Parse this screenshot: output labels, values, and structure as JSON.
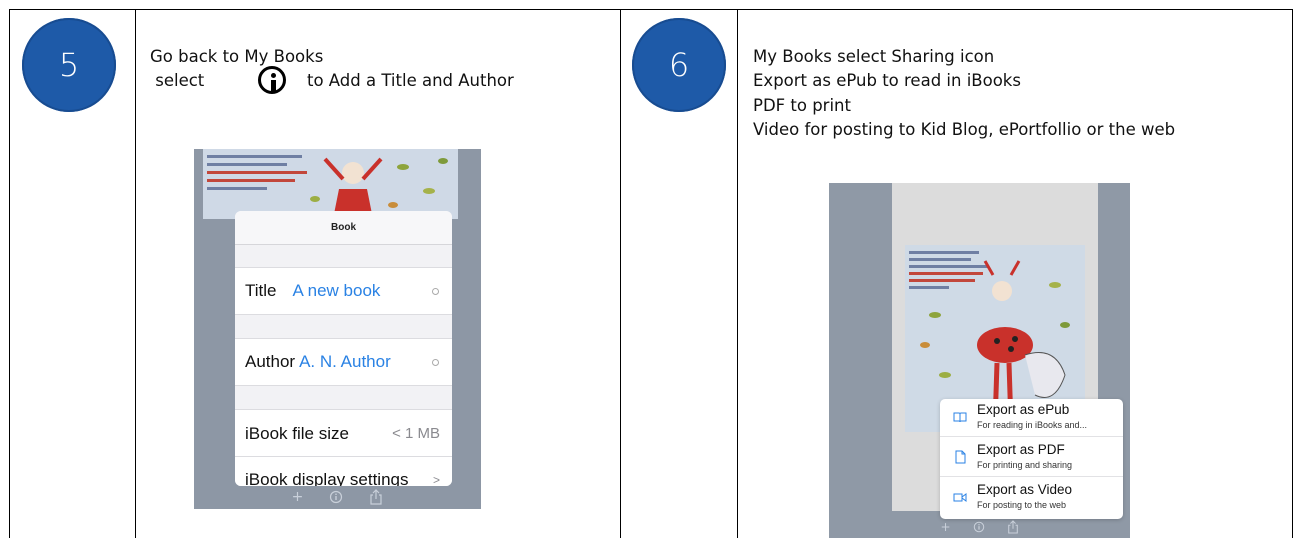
{
  "steps": [
    {
      "number": "5",
      "lines": [
        "Go back to My Books",
        " select",
        "to Add a Title and Author"
      ],
      "screen": {
        "sheet_title": "Book",
        "rows": [
          {
            "label": "Title",
            "value": "A new book"
          },
          {
            "label": "Author",
            "value": "A. N. Author"
          },
          {
            "label": "iBook file size",
            "value": "< 1 MB"
          },
          {
            "label": "iBook display settings",
            "value": ">"
          }
        ],
        "toolbar_icons": [
          "plus-icon",
          "info-icon",
          "share-icon"
        ]
      }
    },
    {
      "number": "6",
      "lines": [
        "My Books select Sharing icon",
        "Export as ePub to read in iBooks",
        "PDF to print",
        "Video for posting to Kid Blog, ePortfollio or the web"
      ],
      "screen": {
        "menu": [
          {
            "title": "Export as ePub",
            "subtitle": "For reading in iBooks and...",
            "icon": "book-icon"
          },
          {
            "title": "Export as PDF",
            "subtitle": "For printing and sharing",
            "icon": "document-icon"
          },
          {
            "title": "Export as Video",
            "subtitle": "For posting to the web",
            "icon": "video-icon"
          }
        ],
        "toolbar_icons": [
          "plus-icon",
          "info-icon",
          "share-icon"
        ]
      }
    }
  ],
  "colors": {
    "step_circle": "#1e5aa8",
    "ios_link_blue": "#2a82e4",
    "screen_background": "#8d97a5"
  }
}
